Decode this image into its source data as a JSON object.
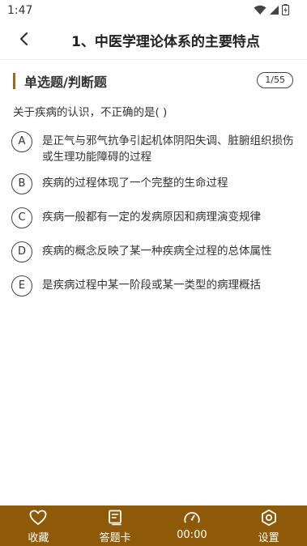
{
  "status_bar": {
    "time": "1:47",
    "icons": [
      "wifi-icon",
      "signal-icon",
      "battery-icon"
    ]
  },
  "header": {
    "title": "1、中医学理论体系的主要特点",
    "back_icon": "chevron-left-icon"
  },
  "section": {
    "title": "单选题/判断题",
    "counter": "1/55",
    "accent_color": "#9a6a1a"
  },
  "question": {
    "text": "关于疾病的认识，不正确的是( )",
    "options": [
      {
        "letter": "A",
        "text": "是正气与邪气抗争引起机体阴阳失调、脏腑组织损伤或生理功能障碍的过程"
      },
      {
        "letter": "B",
        "text": "疾病的过程体现了一个完整的生命过程"
      },
      {
        "letter": "C",
        "text": "疾病一般都有一定的发病原因和病理演变规律"
      },
      {
        "letter": "D",
        "text": "疾病的概念反映了某一种疾病全过程的总体属性"
      },
      {
        "letter": "E",
        "text": "是疾病过程中某一阶段或某一类型的病理概括"
      }
    ]
  },
  "bottom_bar": {
    "bg_color": "#8e5a08",
    "tabs": [
      {
        "label": "收藏",
        "icon": "heart-icon"
      },
      {
        "label": "答题卡",
        "icon": "answer-card-icon"
      },
      {
        "label": "00:00",
        "icon": "timer-icon"
      },
      {
        "label": "设置",
        "icon": "settings-icon"
      }
    ]
  }
}
